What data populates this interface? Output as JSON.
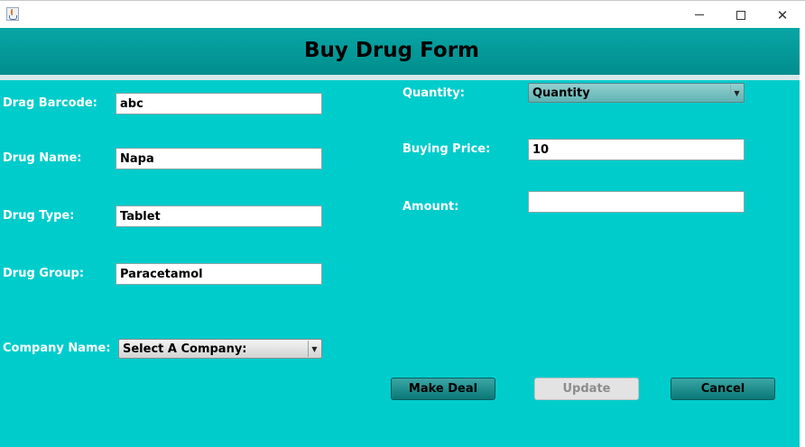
{
  "window": {
    "minimize_glyph": "—",
    "maximize_glyph": "☐",
    "close_glyph": "✕"
  },
  "header": {
    "title": "Buy Drug Form",
    "bg_color": "#019595"
  },
  "form": {
    "bg_color": "#00cccc",
    "drug_barcode": {
      "label": "Drag Barcode:",
      "value": "abc"
    },
    "drug_name": {
      "label": "Drug Name:",
      "value": "Napa"
    },
    "drug_type": {
      "label": "Drug Type:",
      "value": "Tablet"
    },
    "drug_group": {
      "label": "Drug Group:",
      "value": "Paracetamol"
    },
    "company_name": {
      "label": "Company Name:",
      "selected": "Select A Company:"
    },
    "quantity": {
      "label": "Quantity:",
      "selected": "Quantity"
    },
    "buying_price": {
      "label": "Buying Price:",
      "value": "10"
    },
    "amount": {
      "label": "Amount:",
      "value": ""
    }
  },
  "buttons": {
    "make_deal": "Make Deal",
    "update": "Update",
    "cancel": "Cancel"
  }
}
